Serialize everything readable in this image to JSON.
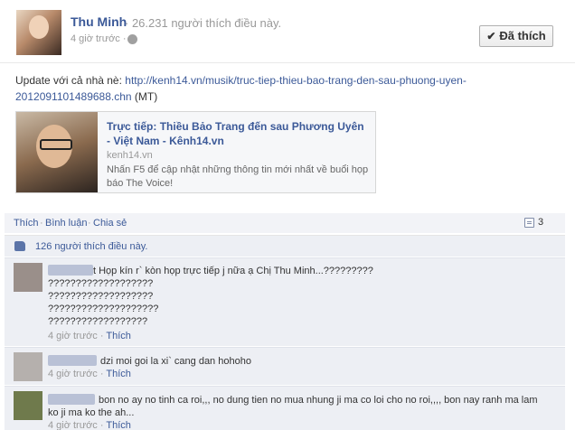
{
  "header": {
    "page_name": "Thu Minh",
    "page_likes": "· 26.231 người thích điều này.",
    "post_time": "4 giờ trước ·",
    "liked_button": "Đã thích",
    "check_glyph": "✔"
  },
  "post": {
    "text_prefix": "Update với cả nhà nè: ",
    "link": "http://kenh14.vn/musik/truc-tiep-thieu-bao-trang-den-sau-phuong-uyen-2012091101489688.chn",
    "text_suffix": " (MT)"
  },
  "share": {
    "title": "Trực tiếp: Thiều Bảo Trang đến sau Phương Uyên - Việt Nam - Kênh14.vn",
    "domain": "kenh14.vn",
    "description": "Nhấn F5 để cập nhật những thông tin mới nhất về buổi họp báo The Voice!"
  },
  "actions": {
    "like": "Thích",
    "comment": "Bình luận",
    "share": "Chia sẻ",
    "separator": "·",
    "comment_count": "3"
  },
  "likes": {
    "text": "126 người thích điều này."
  },
  "comments": [
    {
      "name": "",
      "text_lines": [
        "t Họp kín r` kòn họp trực tiếp j nữa ạ Chị Thu Minh...?????????",
        "???????????????????",
        "???????????????????",
        "????????????????????",
        "??????????????????"
      ],
      "time": "4 giờ trước ·",
      "like": "Thích",
      "avatar_color": "#9a8f8a",
      "name_color": "#b9c1d6"
    },
    {
      "name": "",
      "text_lines": [
        "dzi moi goi la xi` cang dan hohoho"
      ],
      "time": "4 giờ trước ·",
      "like": "Thích",
      "avatar_color": "#b5b0ad",
      "name_color": "#b9c1d6"
    },
    {
      "name": "",
      "text_lines": [
        "bon no ay no tinh ca roi,,, no dung tien no mua nhung ji ma co loi cho no roi,,,, bon nay ranh ma lam",
        "ko ji ma ko the ah..."
      ],
      "time": "4 giờ trước ·",
      "like": "Thích",
      "avatar_color": "#6f7a4c",
      "name_color": "#b9c1d6"
    }
  ],
  "colors": {
    "link": "#3b5998",
    "panel": "#edeff4",
    "muted": "#999999"
  },
  "icons": {
    "globe": "globe-icon",
    "check": "check-icon",
    "thumb": "thumbs-up-icon",
    "comment": "comment-icon"
  }
}
